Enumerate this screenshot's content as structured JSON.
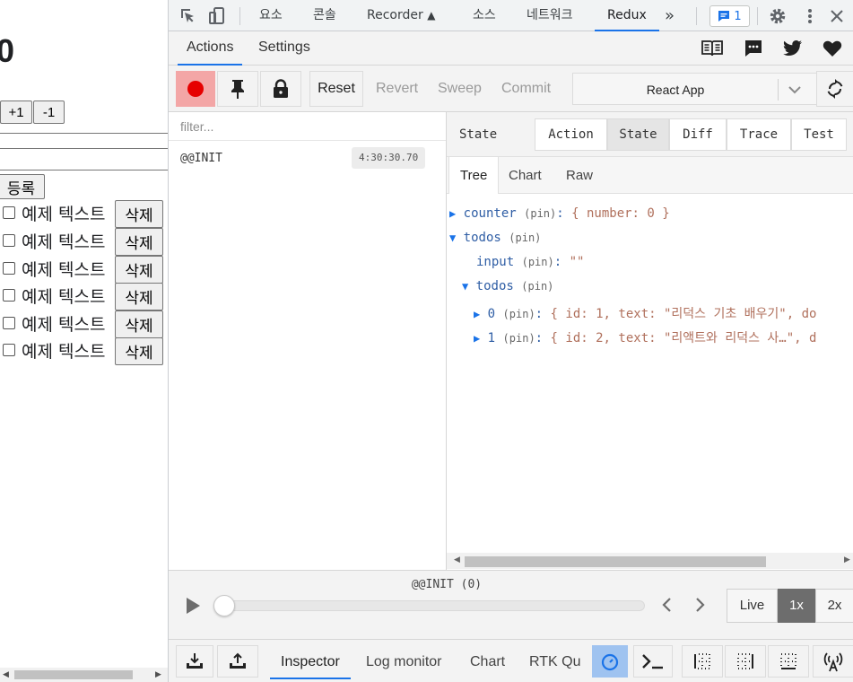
{
  "app": {
    "counter_value": "0",
    "increment_label": "+1",
    "decrement_label": "-1",
    "register_label": "등록",
    "todos": [
      {
        "text": "예제 텍스트",
        "delete_label": "삭제"
      },
      {
        "text": "예제 텍스트",
        "delete_label": "삭제"
      },
      {
        "text": "예제 텍스트",
        "delete_label": "삭제"
      },
      {
        "text": "예제 텍스트",
        "delete_label": "삭제"
      },
      {
        "text": "예제 텍스트",
        "delete_label": "삭제"
      },
      {
        "text": "예제 텍스트",
        "delete_label": "삭제"
      }
    ]
  },
  "devtools": {
    "tabs": [
      "요소",
      "콘솔",
      "Recorder",
      "소스",
      "네트워크",
      "Redux"
    ],
    "active_tab": "Redux",
    "issues_count": "1",
    "more_tabs": "»",
    "colors": {
      "accent": "#1a73e8",
      "record": "#e60000"
    }
  },
  "redux": {
    "subtabs": [
      "Actions",
      "Settings"
    ],
    "toolbar": {
      "reset": "Reset",
      "revert": "Revert",
      "sweep": "Sweep",
      "commit": "Commit",
      "instance": "React App"
    },
    "filter_placeholder": "filter...",
    "actions": [
      {
        "name": "@@INIT",
        "time": "4:30:30.70"
      }
    ],
    "state_panel": {
      "title": "State",
      "modes": [
        "Action",
        "State",
        "Diff",
        "Trace",
        "Test"
      ],
      "active_mode": "State",
      "views": [
        "Tree",
        "Chart",
        "Raw"
      ],
      "active_view": "Tree",
      "tree": {
        "counter_key": "counter",
        "counter_value": "{ number: 0 }",
        "todos_key": "todos",
        "input_key": "input",
        "input_value": "\"\"",
        "todos_inner_key": "todos",
        "item0_key": "0",
        "item0_value": "{ id: 1, text: \"리덕스 기초 배우기\", do",
        "item1_key": "1",
        "item1_value": "{ id: 2, text: \"리액트와 리덕스 사…\", d",
        "pin_label": "(pin)"
      }
    },
    "slider": {
      "label": "@@INIT (0)",
      "position": 0,
      "speeds": [
        "Live",
        "1x",
        "2x"
      ],
      "active_speed": "1x"
    },
    "bottom_tabs": [
      "Inspector",
      "Log monitor",
      "Chart",
      "RTK Que"
    ],
    "active_bottom_tab": "Inspector"
  }
}
